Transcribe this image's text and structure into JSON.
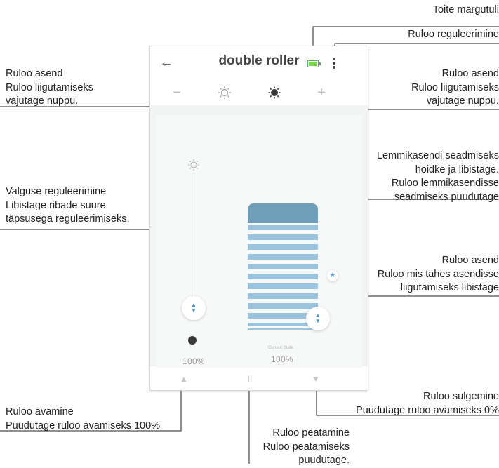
{
  "app": {
    "title": "double roller",
    "back_icon": "arrow-left-icon",
    "battery_icon": "battery-icon",
    "battery_color": "#7cd44a",
    "menu_icon": "more-vertical-icon"
  },
  "toolbar": {
    "minus_label": "−",
    "sun_icon": "sun-icon",
    "moon_icon": "moon-icon",
    "plus_label": "+"
  },
  "light_slider": {
    "value_label": "100%",
    "top_icon": "sun-icon",
    "bottom_icon": "moon-icon"
  },
  "roller": {
    "current_state_label": "Current State",
    "value_label": "100%",
    "slat_color": "#9ac4dd",
    "head_color": "#6f9fb8",
    "favorite_icon": "star-icon"
  },
  "bottom_bar": {
    "open_icon": "triangle-up-icon",
    "pause_label": "II",
    "close_icon": "triangle-down-icon"
  },
  "callouts": {
    "power_indicator": "Toite märgutuli",
    "roller_adjust": "Ruloo reguleerimine",
    "position_left": "Ruloo asend\nRuloo liigutamiseks\nvajutage nuppu.",
    "position_right": "Ruloo asend\nRuloo liigutamiseks\nvajutage nuppu.",
    "favorite": "Lemmikasendi seadmiseks\nhoidke ja libistage.\nRuloo lemmikasendisse\nseadmiseks puudutage",
    "light_adjust": "Valguse reguleerimine\nLibistage ribade suure\ntäpsusega reguleerimiseks.",
    "position_slide": "Ruloo asend\nRuloo mis tahes asendisse\nliigutamiseks libistage",
    "close_roller": "Ruloo sulgemine\nPuudutage ruloo avamiseks 0%",
    "open_roller": "Ruloo avamine\nPuudutage ruloo avamiseks 100%",
    "stop_roller": "Ruloo peatamine\nRuloo peatamiseks\npuudutage."
  }
}
